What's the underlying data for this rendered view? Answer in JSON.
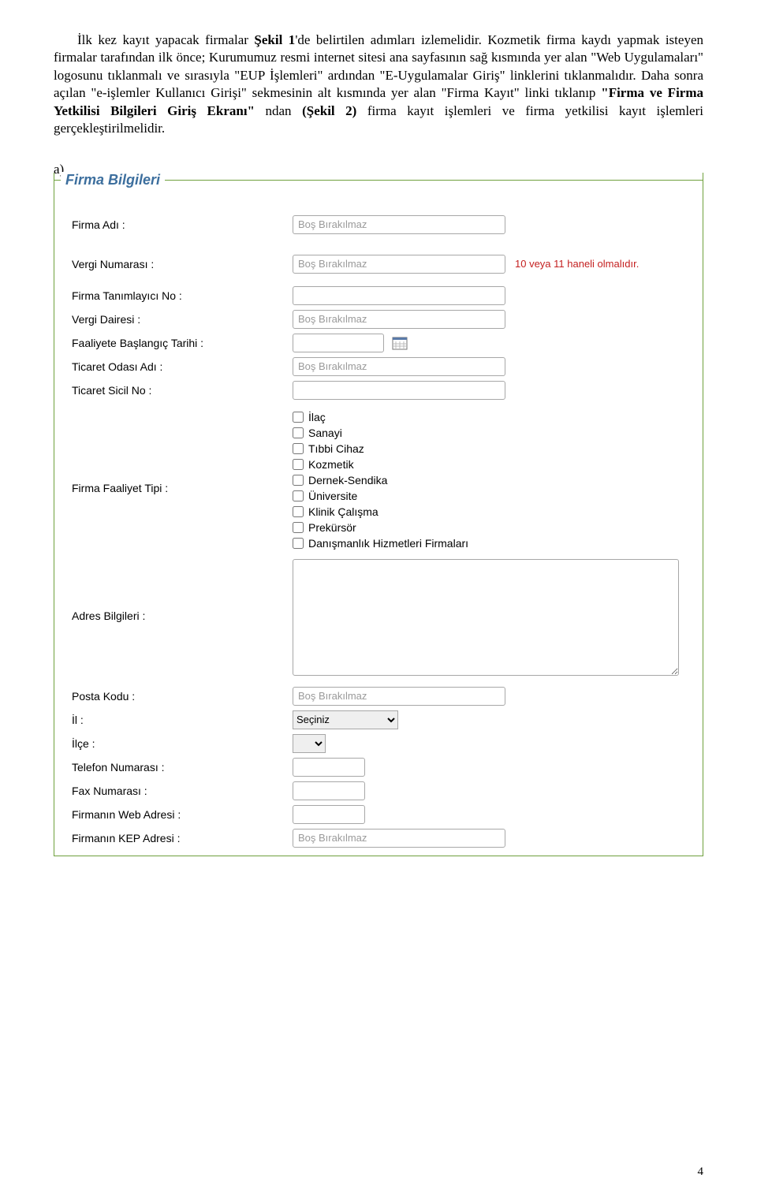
{
  "paragraph": {
    "s1a": "İlk kez kayıt yapacak firmalar ",
    "s1b": "Şekil 1",
    "s1c": "'de belirtilen adımları izlemelidir. Kozmetik firma kaydı yapmak isteyen firmalar tarafından ilk önce; Kurumumuz resmi internet sitesi ana sayfasının sağ kısmında yer alan \"Web Uygulamaları\" logosunu tıklanmalı ve sırasıyla \"EUP İşlemleri\" ardından \"E-Uygulamalar Giriş\" linklerini tıklanmalıdır. Daha sonra açılan \"e-işlemler Kullanıcı Girişi\" sekmesinin alt kısmında yer alan \"Firma Kayıt\" linki tıklanıp ",
    "s2a": "\"Firma ve Firma Yetkilisi Bilgileri Giriş Ekranı\"",
    "s2b": " ndan ",
    "s2c": "(Şekil 2)",
    "s2d": " firma kayıt işlemleri ve firma yetkilisi kayıt işlemleri gerçekleştirilmelidir."
  },
  "sub_a": "a)",
  "legend": "Firma Bilgileri",
  "placeholder_empty": "Boş Bırakılmaz",
  "tax_hint": "10 veya 11 haneli olmalıdır.",
  "labels": {
    "firma_adi": "Firma Adı :",
    "vergi_no": "Vergi Numarası :",
    "firma_tanim_no": "Firma Tanımlayıcı No :",
    "vergi_dairesi": "Vergi Dairesi :",
    "faaliyet_tarih": "Faaliyete Başlangıç Tarihi :",
    "ticaret_odasi": "Ticaret Odası Adı :",
    "ticaret_sicil": "Ticaret Sicil No :",
    "faaliyet_tipi": "Firma Faaliyet Tipi :",
    "adres": "Adres Bilgileri :",
    "posta_kodu": "Posta Kodu :",
    "il": "İl :",
    "ilce": "İlçe :",
    "telefon": "Telefon Numarası :",
    "fax": "Fax Numarası :",
    "web": "Firmanın Web Adresi :",
    "kep": "Firmanın KEP Adresi :"
  },
  "activity_types": [
    "İlaç",
    "Sanayi",
    "Tıbbi Cihaz",
    "Kozmetik",
    "Dernek-Sendika",
    "Üniversite",
    "Klinik Çalışma",
    "Prekürsör",
    "Danışmanlık Hizmetleri Firmaları"
  ],
  "il_placeholder": "Seçiniz",
  "page_number": "4"
}
